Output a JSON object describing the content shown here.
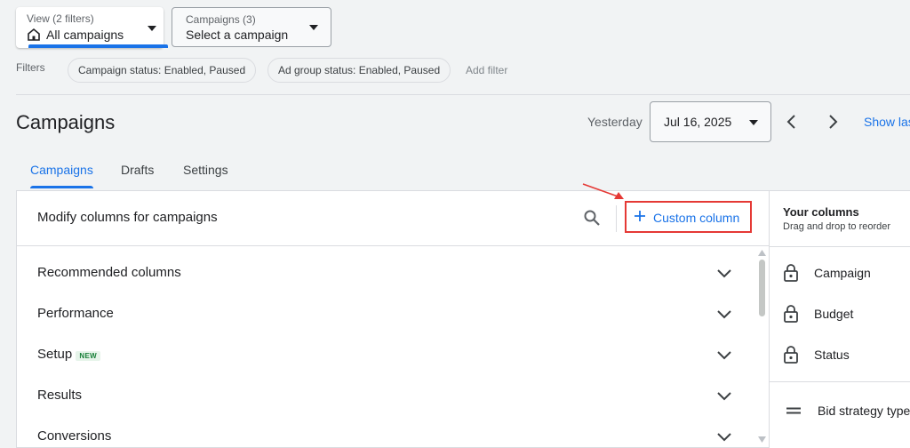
{
  "view_selector": {
    "sub_label": "View (2 filters)",
    "value": "All campaigns"
  },
  "campaign_selector": {
    "sub_label": "Campaigns (3)",
    "value": "Select a campaign"
  },
  "filters": {
    "label": "Filters",
    "chips": [
      "Campaign status: Enabled, Paused",
      "Ad group status: Enabled, Paused"
    ],
    "add_filter": "Add filter"
  },
  "header": {
    "title": "Campaigns",
    "date_label": "Yesterday",
    "date_value": "Jul 16, 2025",
    "show_last": "Show las"
  },
  "tabs": [
    {
      "label": "Campaigns",
      "active": true
    },
    {
      "label": "Drafts",
      "active": false
    },
    {
      "label": "Settings",
      "active": false
    }
  ],
  "modify_panel": {
    "title": "Modify columns for campaigns",
    "custom_column_label": "Custom column",
    "sections": [
      {
        "label": "Recommended columns"
      },
      {
        "label": "Performance"
      },
      {
        "label": "Setup",
        "badge": "NEW"
      },
      {
        "label": "Results"
      },
      {
        "label": "Conversions"
      }
    ]
  },
  "your_columns": {
    "title": "Your columns",
    "hint": "Drag and drop to reorder",
    "locked": [
      "Campaign",
      "Budget",
      "Status"
    ],
    "draggable": [
      "Bid strategy type"
    ]
  },
  "colors": {
    "accent": "#1a73e8",
    "highlight": "#e53935",
    "badge_green": "#188038"
  },
  "icons": [
    "home-icon",
    "caret-down-icon",
    "chevron-left-icon",
    "chevron-right-icon",
    "search-icon",
    "plus-icon",
    "chevron-down-icon",
    "lock-icon",
    "drag-handle-icon"
  ]
}
